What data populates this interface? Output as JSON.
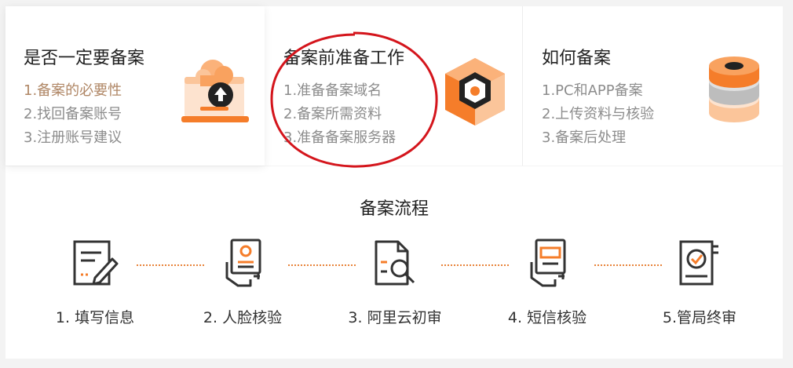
{
  "cards": [
    {
      "title": "是否一定要备案",
      "items": [
        "1.备案的必要性",
        "2.找回备案账号",
        "3.注册账号建议"
      ],
      "icon": "cloud-upload-laptop-icon"
    },
    {
      "title": "备案前准备工作",
      "items": [
        "1.准备备案域名",
        "2.备案所需资料",
        "3.准备备案服务器"
      ],
      "icon": "server-cube-icon"
    },
    {
      "title": "如何备案",
      "items": [
        "1.PC和APP备案",
        "2.上传资料与核验",
        "3.备案后处理"
      ],
      "icon": "database-stack-icon"
    }
  ],
  "flow": {
    "title": "备案流程",
    "steps": [
      {
        "label": "1. 填写信息",
        "icon": "fill-form-icon"
      },
      {
        "label": "2. 人脸核验",
        "icon": "face-verify-icon"
      },
      {
        "label": "3. 阿里云初审",
        "icon": "document-search-icon"
      },
      {
        "label": "4. 短信核验",
        "icon": "sms-verify-icon"
      },
      {
        "label": "5.管局终审",
        "icon": "final-review-icon"
      }
    ]
  },
  "colors": {
    "accent": "#f57d2a",
    "light_accent": "#fbc59a",
    "active_item": "#b08766",
    "annotation": "#d4151c"
  }
}
